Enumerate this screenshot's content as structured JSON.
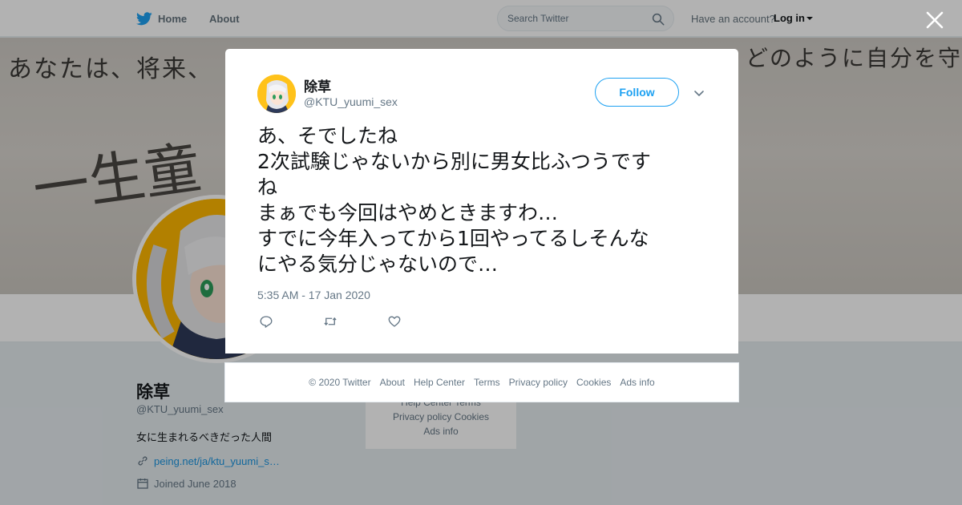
{
  "topbar": {
    "home_label": "Home",
    "about_label": "About",
    "search_placeholder": "Search Twitter",
    "have_account_text": "Have an account?",
    "login_label": "Log in"
  },
  "banner": {
    "line_left": "あなたは、将来、",
    "line_right": "どのように自分を守りますか",
    "handwriting": "一生童"
  },
  "profile": {
    "name": "除草",
    "handle": "@KTU_yuumi_sex",
    "bio": "女に生まれるべきだった人間",
    "link": "peing.net/ja/ktu_yuumi_s…",
    "joined": "Joined June 2018"
  },
  "side_footer": {
    "line1": "Help Center   Terms",
    "line2": "Privacy policy   Cookies",
    "line3": "Ads info"
  },
  "tweet": {
    "name": "除草",
    "handle": "@KTU_yuumi_sex",
    "follow_label": "Follow",
    "lines": [
      "あ、そでしたね",
      "2次試験じゃないから別に男女比ふつうです",
      "ね",
      "まぁでも今回はやめときますわ…",
      "すでに今年入ってから1回やってるしそんな",
      "にやる気分じゃないので…"
    ],
    "timestamp": "5:35 AM - 17 Jan 2020"
  },
  "footer": {
    "copyright": "© 2020 Twitter",
    "about": "About",
    "help": "Help Center",
    "terms": "Terms",
    "privacy": "Privacy policy",
    "cookies": "Cookies",
    "ads": "Ads info"
  },
  "icons": {
    "brand": "twitter-bird-icon",
    "search": "search-icon",
    "close": "close-icon",
    "reply": "reply-icon",
    "retweet": "retweet-icon",
    "like": "heart-icon"
  },
  "colors": {
    "accent": "#1da1f2",
    "muted": "#657786",
    "link": "#1b95e0"
  }
}
